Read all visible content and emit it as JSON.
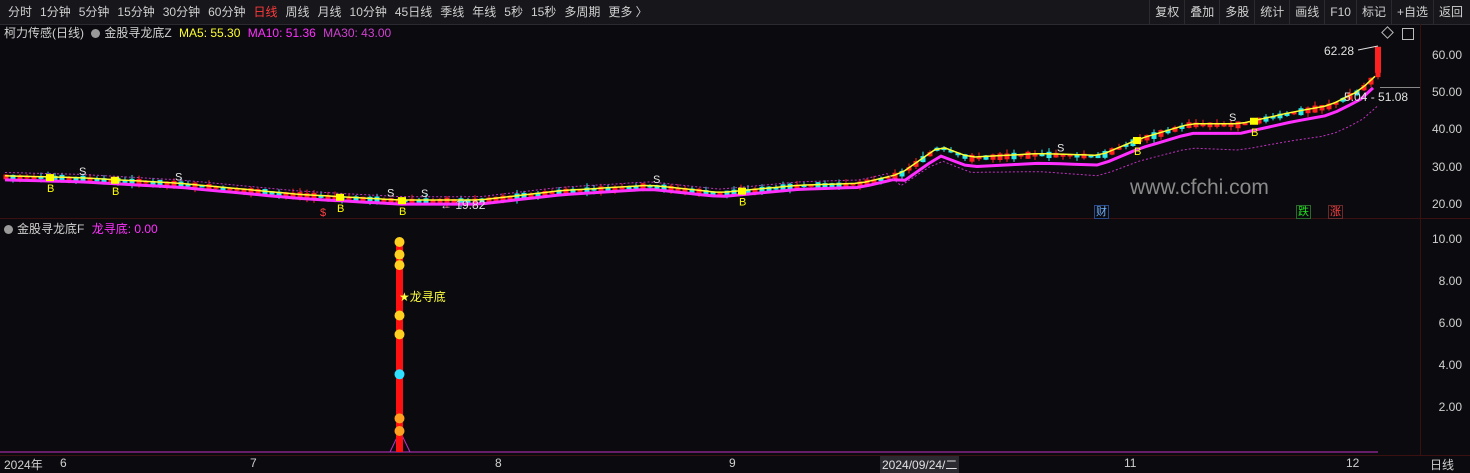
{
  "toolbar": {
    "left_items": [
      "分时",
      "1分钟",
      "5分钟",
      "15分钟",
      "30分钟",
      "60分钟",
      "日线",
      "周线",
      "月线",
      "10分钟",
      "45日线",
      "季线",
      "年线",
      "5秒",
      "15秒",
      "多周期",
      "更多 〉"
    ],
    "active_item": "日线",
    "right_items": [
      "复权",
      "叠加",
      "多股",
      "统计",
      "画线",
      "F10",
      "标记",
      "+自选",
      "返回"
    ]
  },
  "main_panel": {
    "stock_name": "柯力传感(日线)",
    "indicator_name": "金股寻龙底Z",
    "ma5_label": "MA5: 55.30",
    "ma10_label": "MA10: 51.36",
    "ma30_label": "MA30: 43.00",
    "high_label": "62.28",
    "low_label": "← 19.82",
    "range_label": "5.04 - 51.08",
    "watermark": "www.cfchi.com",
    "y_ticks": [
      "60.00",
      "50.00",
      "40.00",
      "30.00",
      "20.00"
    ],
    "signal_texts": {
      "s": "S",
      "b": "B",
      "cai": "财",
      "die": "跌",
      "zhang": "涨"
    }
  },
  "sub_panel": {
    "indicator_name": "金股寻龙底F",
    "value_label": "龙寻底: 0.00",
    "signal_label": "★龙寻底",
    "y_ticks": [
      "10.00",
      "8.00",
      "6.00",
      "4.00",
      "2.00"
    ]
  },
  "date_axis": {
    "labels": [
      "2024年",
      "6",
      "7",
      "8",
      "9",
      "2024/09/24/二",
      "11",
      "12"
    ],
    "period_label": "日线"
  },
  "colors": {
    "up": "#ff2020",
    "down": "#2ee8e8",
    "ma5": "#ffff30",
    "ma10": "#ff30ff",
    "ma30": "#c030c0",
    "signal_yellow": "#ffff00"
  }
}
